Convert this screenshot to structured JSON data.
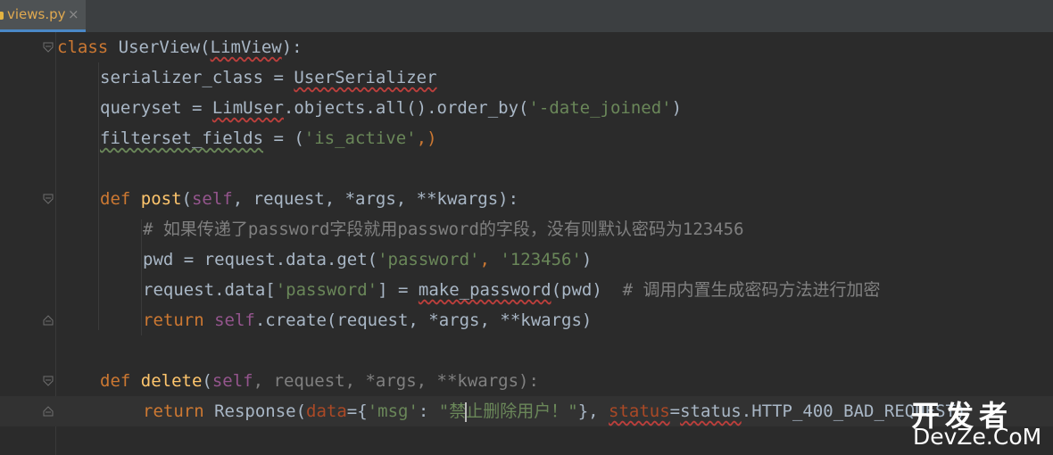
{
  "tab": {
    "filename": "views.py",
    "close": "×"
  },
  "code": {
    "l1": {
      "kw": "class",
      "name": "UserView",
      "open": "(",
      "base": "LimView",
      "close": "):"
    },
    "l2": {
      "a": "serializer_class",
      "b": " = ",
      "c": "UserSerializer"
    },
    "l3": {
      "a": "queryset = ",
      "b": "LimUser",
      "c": ".objects.all().order_by(",
      "d": "'-date_joined'",
      "e": ")"
    },
    "l4": {
      "a": "filterset_fields",
      "b": " = (",
      "c": "'is_active'",
      "d": ",)"
    },
    "l6": {
      "kw": "def ",
      "fn": "post",
      "p1": "(",
      "self": "self",
      "p2": ", request, *args, **kwargs):"
    },
    "l7": {
      "comment": "# 如果传递了password字段就用password的字段，没有则默认密码为123456"
    },
    "l8": {
      "a": "pwd = request.data.get(",
      "b": "'password'",
      "c": ", ",
      "d": "'123456'",
      "e": ")"
    },
    "l9": {
      "a": "request.data[",
      "b": "'password'",
      "c": "] = ",
      "d": "make_password",
      "e": "(pwd)  ",
      "comment": "# 调用内置生成密码方法进行加密"
    },
    "l10": {
      "kw": "return ",
      "self": "self",
      "a": ".create(request, *args, **kwargs)"
    },
    "l12": {
      "kw": "def ",
      "fn": "delete",
      "p1": "(",
      "self": "self",
      "p2": ", request, *args, **kwargs):"
    },
    "l13": {
      "kw": "return ",
      "a": "Response(",
      "param1": "data",
      "b": "={",
      "s1": "'msg'",
      "c": ": ",
      "s2a": "\"禁",
      "s2b": "止删除用户！\"",
      "d": "}, ",
      "param2": "status",
      "e": "=",
      "f": "status",
      "g": ".HTTP_400_BAD_REQUEST)"
    }
  },
  "watermark": {
    "top": "开发者",
    "bottom": "DevZe.CoM"
  },
  "colors": {
    "background": "#2b2b2b",
    "keyword": "#cc7832",
    "function": "#ffc66d",
    "string": "#6a8759",
    "self": "#94558d",
    "comment": "#808080",
    "text": "#a9b7c6"
  }
}
